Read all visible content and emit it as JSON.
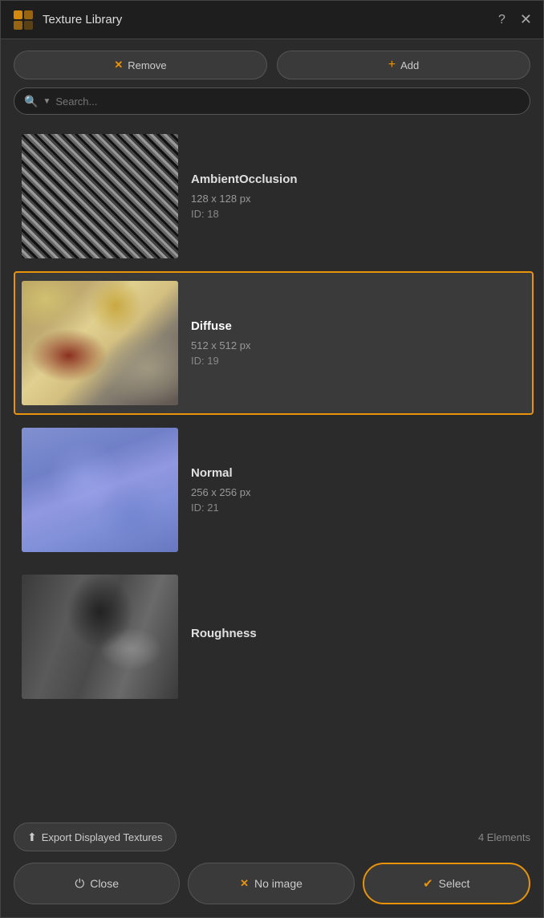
{
  "window": {
    "title": "Texture Library",
    "help_label": "?",
    "close_label": "✕"
  },
  "toolbar": {
    "remove_label": "Remove",
    "add_label": "Add"
  },
  "search": {
    "placeholder": "Search..."
  },
  "textures": [
    {
      "id": "ao",
      "name": "AmbientOcclusion",
      "size": "128 x 128 px",
      "id_label": "ID: 18",
      "selected": false
    },
    {
      "id": "diffuse",
      "name": "Diffuse",
      "size": "512 x 512 px",
      "id_label": "ID: 19",
      "selected": true
    },
    {
      "id": "normal",
      "name": "Normal",
      "size": "256 x 256 px",
      "id_label": "ID: 21",
      "selected": false
    },
    {
      "id": "roughness",
      "name": "Roughness",
      "size": "",
      "id_label": "",
      "selected": false
    }
  ],
  "bottom": {
    "export_label": "Export Displayed Textures",
    "elements_label": "4 Elements"
  },
  "actions": {
    "close_label": "Close",
    "no_image_label": "No image",
    "select_label": "Select"
  },
  "colors": {
    "accent": "#e8930a",
    "selected_bg": "#3a3a3a"
  }
}
